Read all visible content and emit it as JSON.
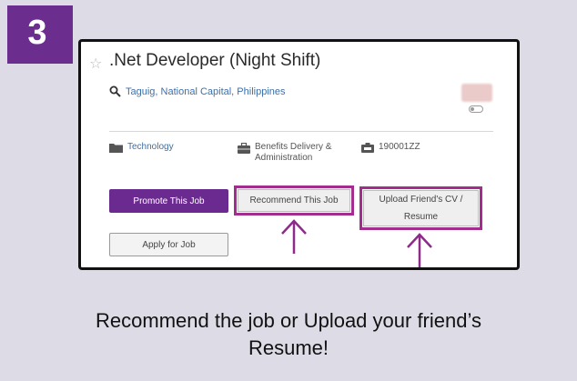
{
  "step": {
    "number": "3",
    "color": "#6b2d8e"
  },
  "job": {
    "favorite_icon": "star-outline-icon",
    "title": ".Net Developer (Night Shift)",
    "location": "Taguig, National Capital, Philippines",
    "location_icon": "search-icon",
    "category": "Technology",
    "category_icon": "folder-icon",
    "function_line1": "Benefits Delivery &",
    "function_line2": "Administration",
    "function_icon": "briefcase-icon",
    "requisition_id": "190001ZZ",
    "requisition_icon": "id-badge-icon"
  },
  "buttons": {
    "promote_label": "Promote This Job",
    "recommend_label": "Recommend This Job",
    "upload_label_line1": "Upload Friend's CV /",
    "upload_label_line2": "Resume",
    "apply_label": "Apply for Job"
  },
  "caption": {
    "line1": "Recommend the job or Upload your friend’s",
    "line2": "Resume!"
  },
  "colors": {
    "accent_purple": "#6b2a8f",
    "highlight_magenta": "#a32c8f",
    "link_blue": "#3d6fa8",
    "background": "#dcdbe6"
  }
}
